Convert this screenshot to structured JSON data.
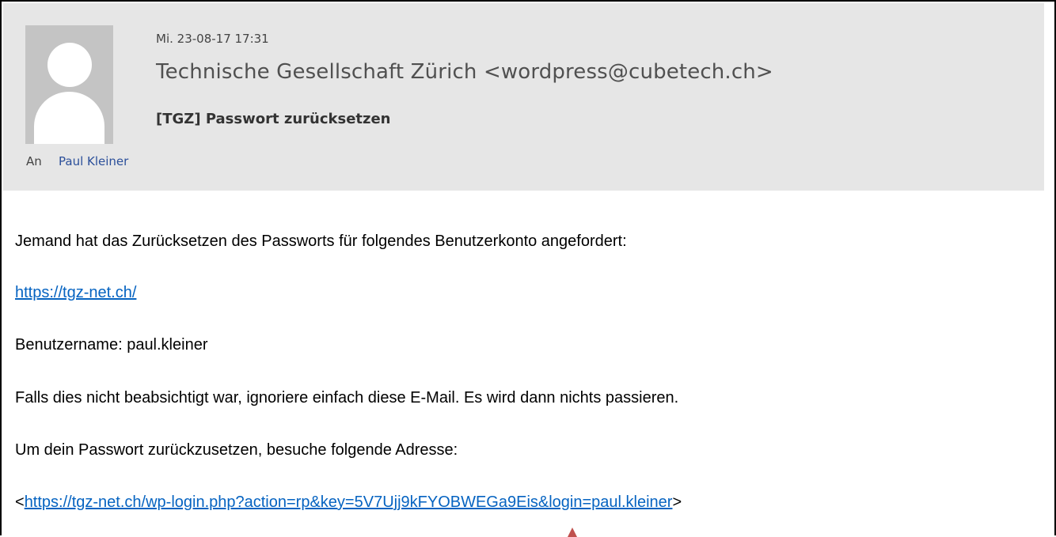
{
  "header": {
    "date": "Mi. 23-08-17 17:31",
    "sender": "Technische Gesellschaft Zürich <wordpress@cubetech.ch>",
    "subject": "[TGZ] Passwort zurücksetzen",
    "to_label": "An",
    "to_name": "Paul Kleiner"
  },
  "body": {
    "line1": "Jemand hat das Zurücksetzen des Passworts für folgendes Benutzerkonto angefordert:",
    "site_link": "https://tgz-net.ch/",
    "username_line": "Benutzername: paul.kleiner",
    "ignore_line": "Falls dies nicht beabsichtigt war, ignoriere einfach diese E-Mail. Es wird dann nichts passieren.",
    "reset_intro": "Um dein Passwort zurückzusetzen, besuche folgende Adresse:",
    "reset_prefix": "<",
    "reset_link": "https://tgz-net.ch/wp-login.php?action=rp&key=5V7Ujj9kFYOBWEGa9Eis&login=paul.kleiner",
    "reset_suffix": ">"
  },
  "colors": {
    "header_bg": "#e6e6e6",
    "link": "#0563c1",
    "recipient": "#2b4f9a",
    "marker": "#c0504d"
  },
  "icons": {
    "avatar": "person-placeholder-icon",
    "marker": "arrow-up-marker-icon"
  }
}
